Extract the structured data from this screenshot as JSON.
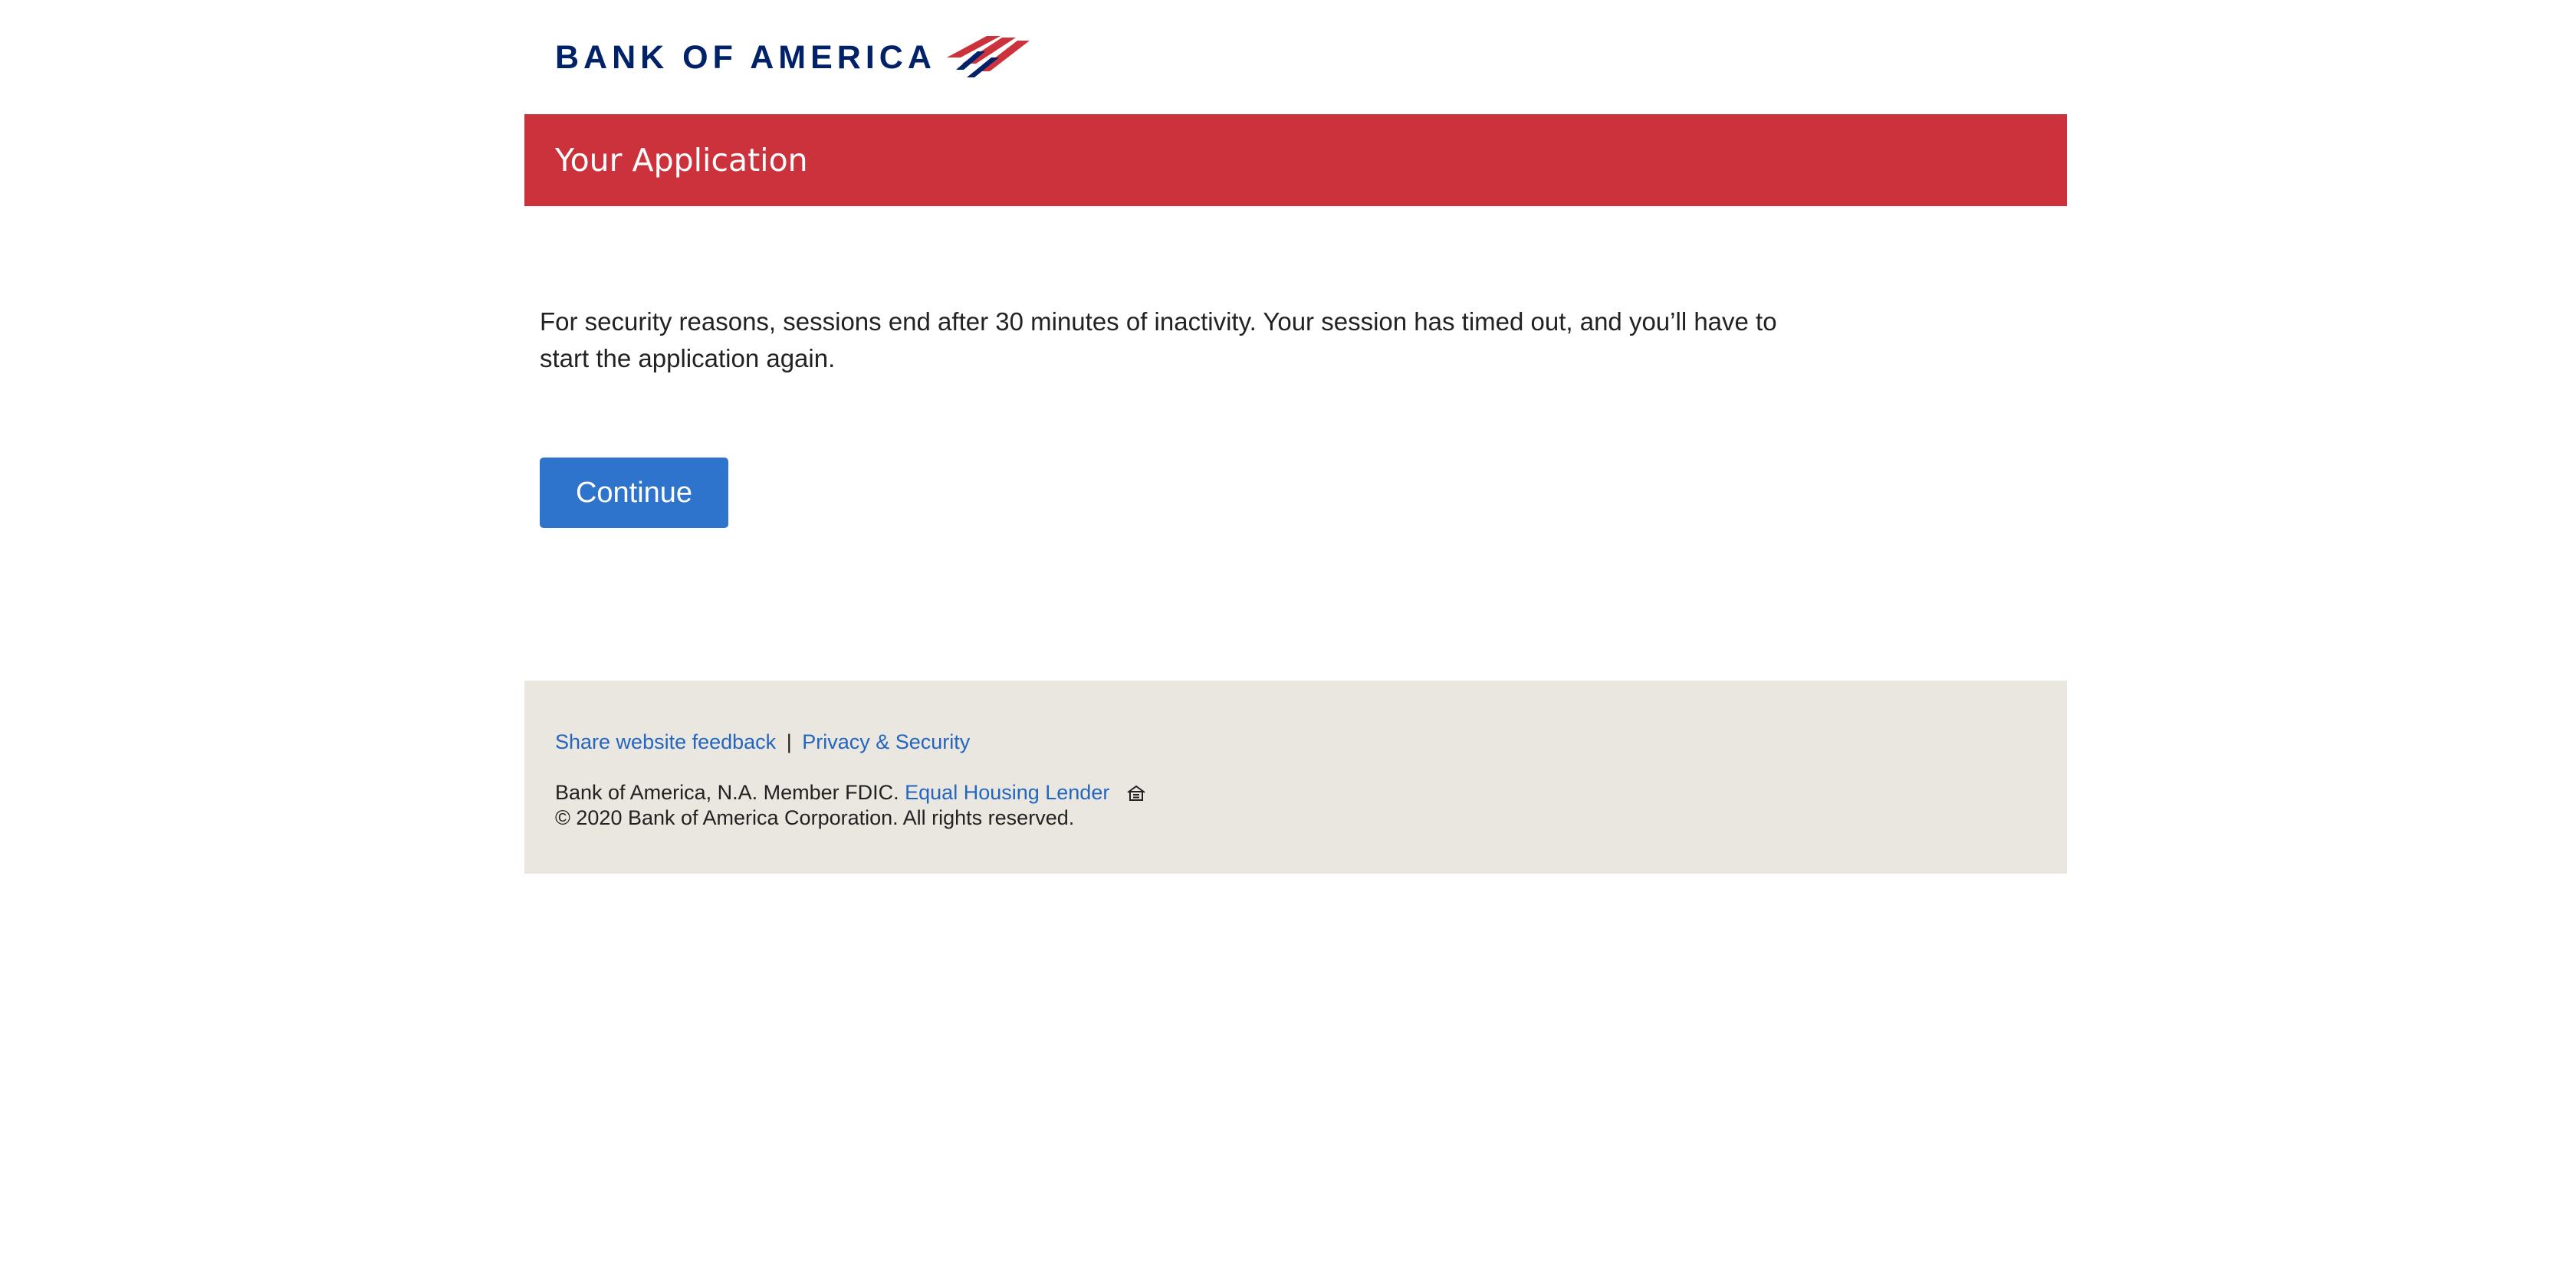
{
  "brand": {
    "logo_text": "BANK OF AMERICA",
    "navy": "#012169",
    "red": "#cc323b",
    "flag_icon": "boa-flag-logo-icon"
  },
  "header": {
    "title": "Your Application"
  },
  "main": {
    "message": "For security reasons, sessions end after 30 minutes of inactivity. Your session has timed out, and you’ll have to start the application again.",
    "continue_label": "Continue",
    "button_color": "#2e74cc"
  },
  "footer": {
    "feedback_link": "Share website feedback",
    "separator": "|",
    "privacy_link": "Privacy & Security",
    "member_text": "Bank of America, N.A. Member FDIC.",
    "housing_link": "Equal Housing Lender",
    "housing_icon": "equal-housing-icon",
    "copyright": "© 2020 Bank of America Corporation. All rights reserved.",
    "background": "#eae6e0",
    "link_color": "#2266c0"
  }
}
